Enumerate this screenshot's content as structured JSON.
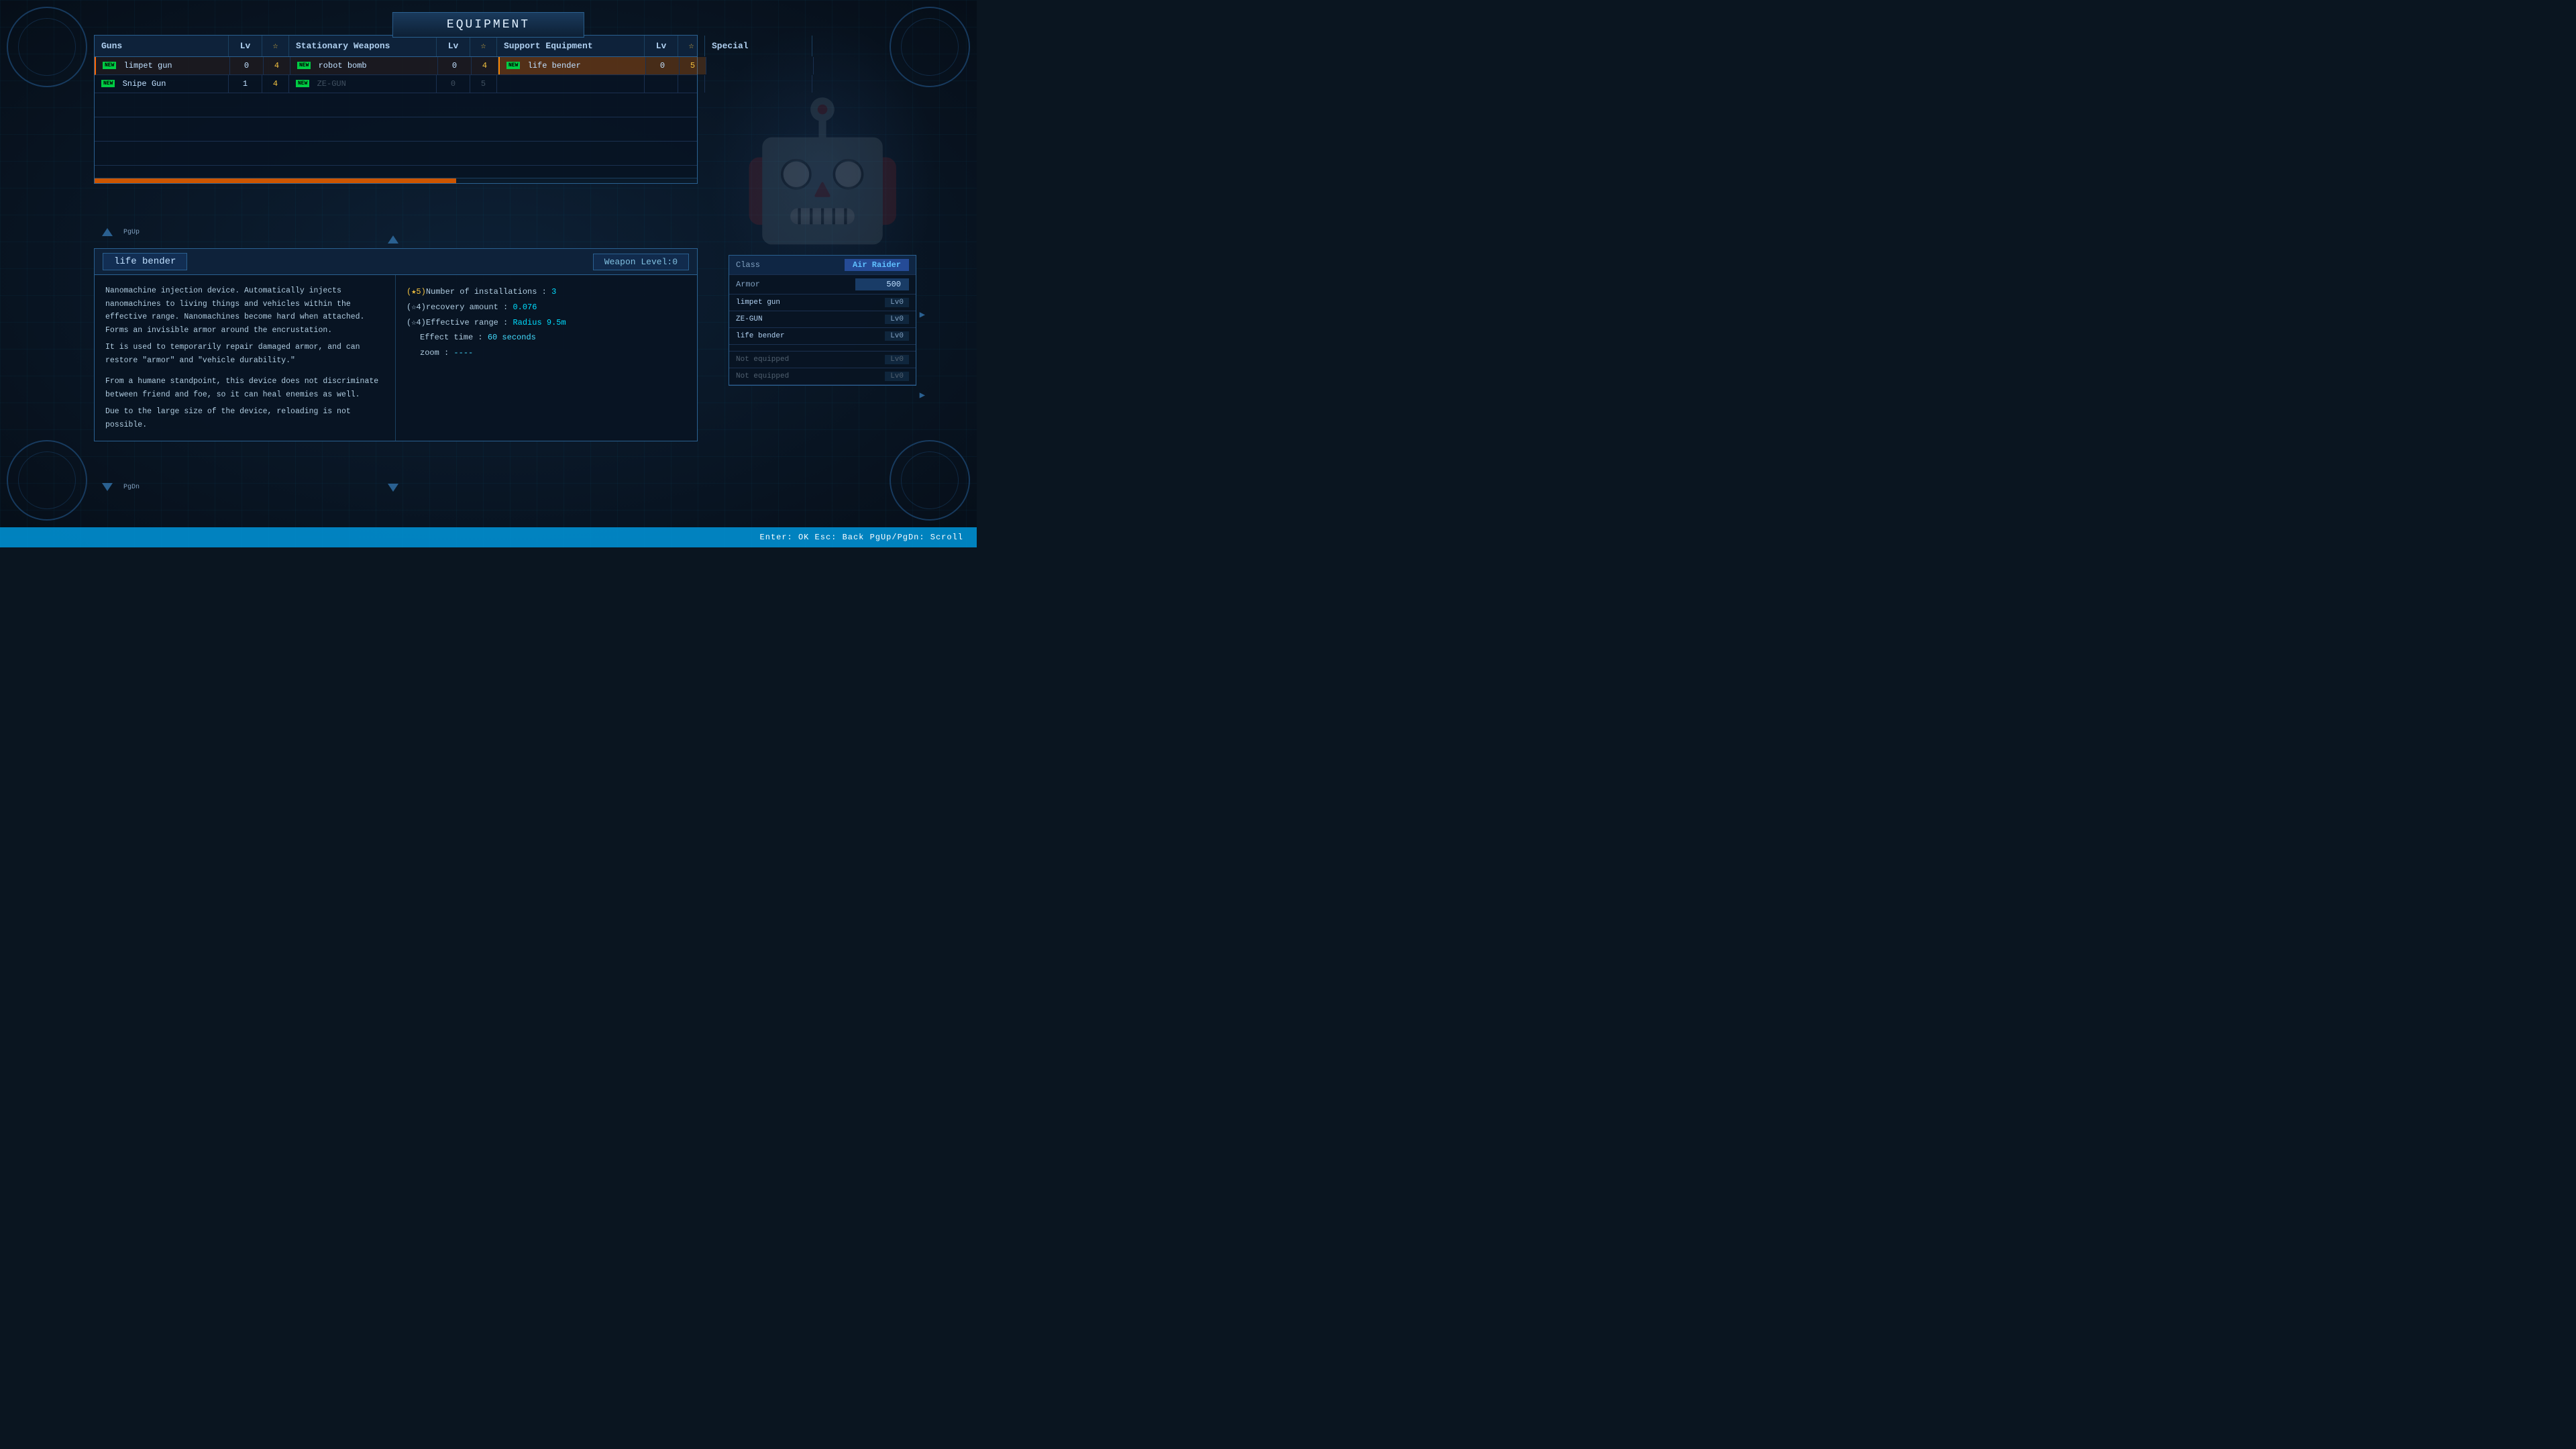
{
  "title": "Equipment",
  "colors": {
    "accent": "#ff8800",
    "highlight": "#00ddff",
    "text_primary": "#c0e0ff",
    "text_dim": "#506070",
    "new_badge": "#00cc44",
    "bg_dark": "#060e18",
    "bg_panel": "#08141f",
    "border": "#2a6090"
  },
  "table": {
    "columns": [
      {
        "label": "Guns",
        "lv": "Lv",
        "star": "☆"
      },
      {
        "label": "Stationary Weapons",
        "lv": "Lv",
        "star": "☆"
      },
      {
        "label": "Support Equipment",
        "lv": "Lv",
        "star": "☆"
      },
      {
        "label": "Special",
        "lv": "",
        "star": ""
      }
    ],
    "rows": [
      {
        "guns_name": "limpet gun",
        "guns_new": true,
        "guns_lv": "0",
        "guns_star": "4",
        "stat_name": "robot bomb",
        "stat_new": true,
        "stat_lv": "0",
        "stat_star": "4",
        "sup_name": "life bender",
        "sup_new": true,
        "sup_lv": "0",
        "sup_star": "5",
        "special_name": "",
        "selected_sup": true
      },
      {
        "guns_name": "Snipe Gun",
        "guns_new": true,
        "guns_lv": "1",
        "guns_star": "4",
        "stat_name": "ZE-GUN",
        "stat_new": true,
        "stat_lv": "0",
        "stat_star": "5",
        "sup_name": "",
        "sup_lv": "",
        "sup_star": "",
        "special_name": "",
        "item_dimmed_stat": true
      }
    ]
  },
  "detail": {
    "item_name": "life bender",
    "weapon_level_label": "Weapon Level:",
    "weapon_level_value": "0",
    "description": "Nanomachine injection device. Automatically injects nanomachines to living things and vehicles within the effective range. Nanomachines become hard when attached. Forms an invisible armor around the encrustation.\nIt is used to temporarily repair damaged armor, and can restore \"armor\" and \"vehicle durability.\"\n\nFrom a humane standpoint, this device does not discriminate between friend and foe, so it can heal enemies as well.\nDue to the large size of the device, reloading is not possible.",
    "stats": {
      "line1_prefix": "(★5)Number of installations : ",
      "line1_value": "3",
      "line2_prefix": "(☆4)recovery amount : ",
      "line2_value": "0.076",
      "line3_prefix": "(☆4)Effective range : ",
      "line3_value": "Radius 9.5m",
      "line4_label": "Effect time : ",
      "line4_value": "60 seconds",
      "line5_label": "zoom : ",
      "line5_value": "----"
    }
  },
  "character": {
    "class_label": "Class",
    "class_value": "Air Raider",
    "armor_label": "Armor",
    "armor_value": "500",
    "equip1_name": "limpet gun",
    "equip1_lv": "Lv0",
    "equip2_name": "ZE-GUN",
    "equip2_lv": "Lv0",
    "equip3_name": "life bender",
    "equip3_lv": "Lv0",
    "equip4_name": "Not equipped",
    "equip4_lv": "Lv0",
    "equip5_name": "Not equipped",
    "equip5_lv": "Lv0"
  },
  "navigation": {
    "pgup": "PgUp",
    "pgdn": "PgDn",
    "hint": "Enter: OK  Esc: Back  PgUp/PgDn: Scroll"
  }
}
